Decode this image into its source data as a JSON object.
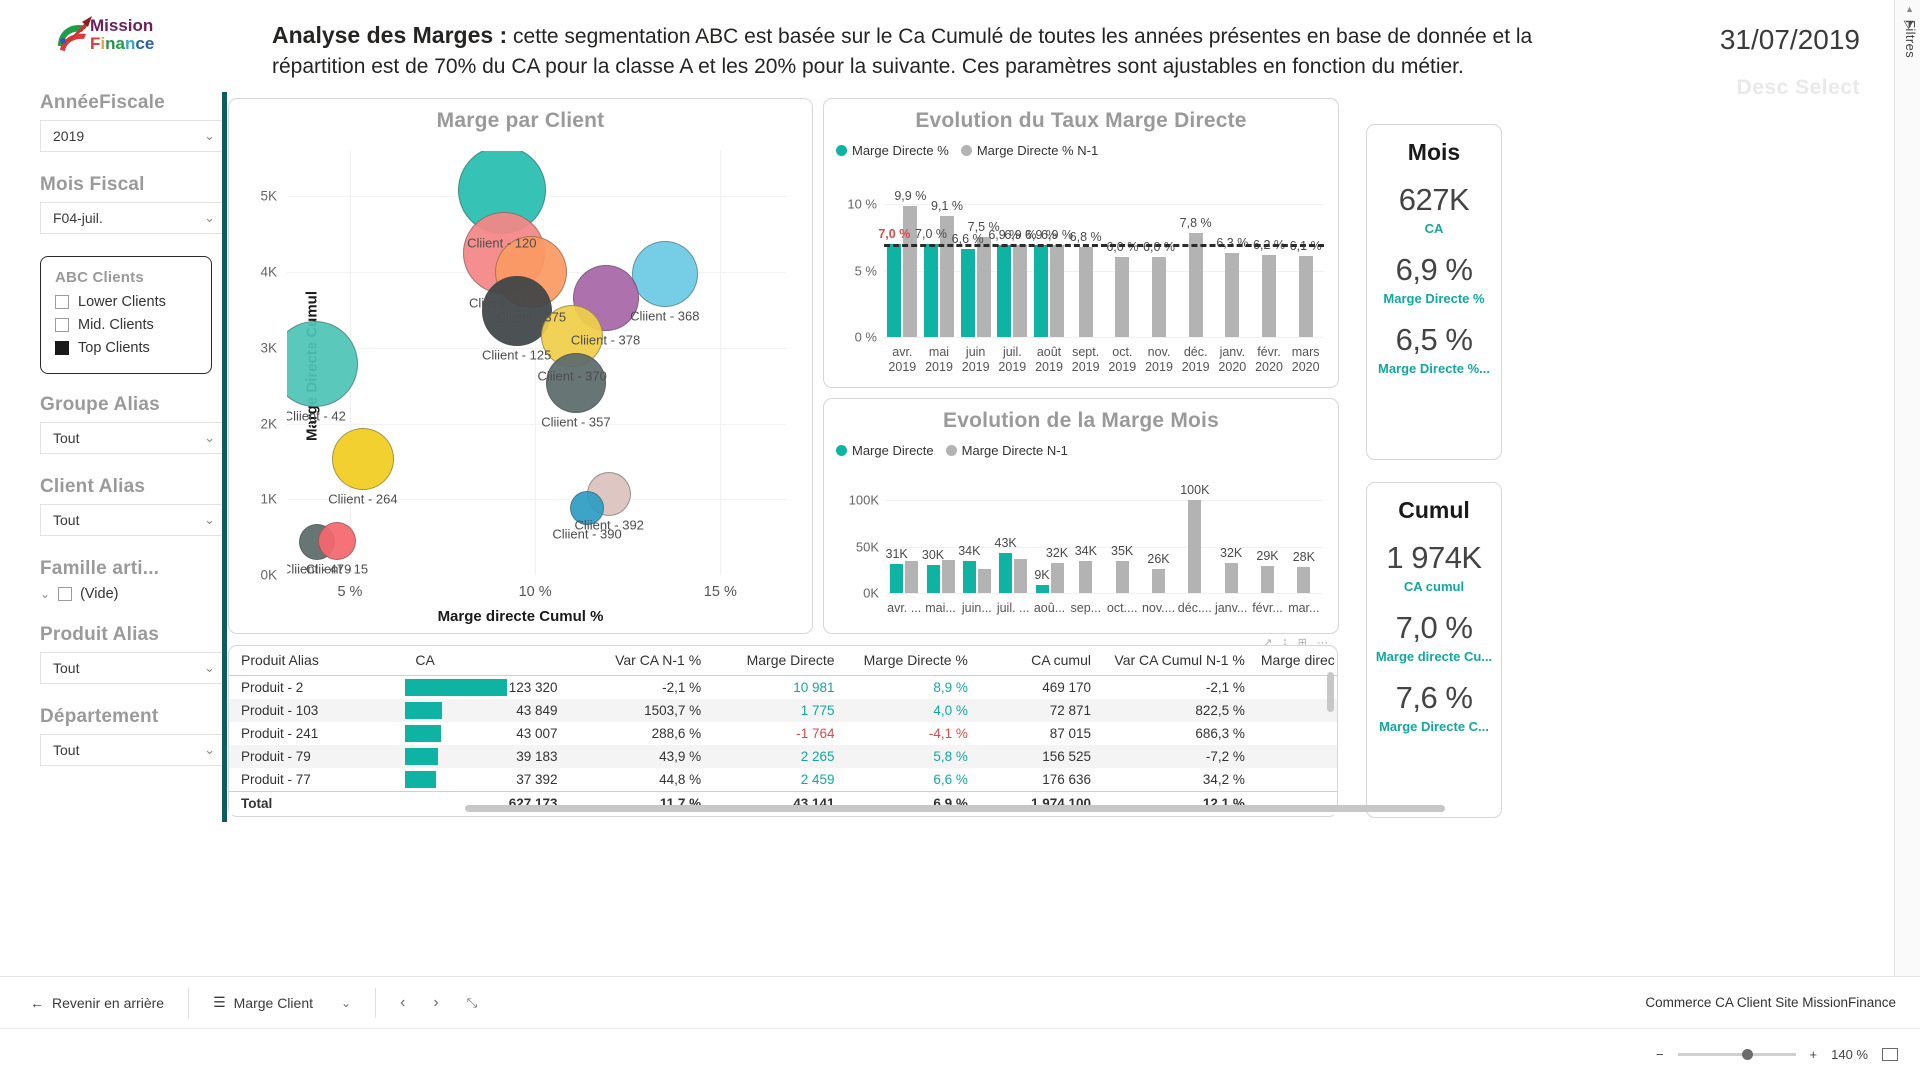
{
  "brand": {
    "line1": "Mission",
    "line2": "Finance"
  },
  "header": {
    "title_bold": "Analyse des Marges :",
    "title_rest": " cette segmentation ABC est basée sur le Ca Cumulé de toutes les années présentes en base de donnée et la répartition est de 70% du CA pour la classe A et les 20% pour la suivante. Ces paramètres sont ajustables en fonction du métier.",
    "date": "31/07/2019",
    "sub": "Desc Select"
  },
  "right_rail": {
    "filters_label": "Filtres",
    "filter_icon": "filter-icon"
  },
  "sidebar": {
    "annee_fiscale": {
      "label": "AnnéeFiscale",
      "value": "2019"
    },
    "mois_fiscal": {
      "label": "Mois Fiscal",
      "value": "F04-juil."
    },
    "abc": {
      "label": "ABC Clients",
      "items": [
        {
          "label": "Lower Clients",
          "checked": false
        },
        {
          "label": "Mid. Clients",
          "checked": false
        },
        {
          "label": "Top Clients",
          "checked": true
        }
      ]
    },
    "groupe_alias": {
      "label": "Groupe Alias",
      "value": "Tout"
    },
    "client_alias": {
      "label": "Client Alias",
      "value": "Tout"
    },
    "famille": {
      "label": "Famille arti...",
      "item": "(Vide)"
    },
    "produit_alias": {
      "label": "Produit Alias",
      "value": "Tout"
    },
    "departement": {
      "label": "Département",
      "value": "Tout"
    }
  },
  "chart_data": [
    {
      "type": "scatter",
      "id": "marge-par-client",
      "title": "Marge par Client",
      "xlabel": "Marge directe Cumul %",
      "ylabel": "Marge Directe Cumul",
      "xlim": [
        3.3,
        16.8
      ],
      "ylim": [
        0,
        5600
      ],
      "xticks": [
        "5 %",
        "10 %",
        "15 %"
      ],
      "xtick_values": [
        5,
        10,
        15
      ],
      "yticks": [
        "0K",
        "1K",
        "2K",
        "3K",
        "4K",
        "5K"
      ],
      "ytick_values": [
        0,
        1000,
        2000,
        3000,
        4000,
        5000
      ],
      "points": [
        {
          "label": "Cliient - 120",
          "x": 9.1,
          "y": 5080,
          "r": 44,
          "color": "#27bfb0"
        },
        {
          "label": "Cliient - 513",
          "x": 9.15,
          "y": 4250,
          "r": 41,
          "color": "#f58787"
        },
        {
          "label": "Cliient - 375",
          "x": 9.9,
          "y": 4000,
          "r": 36,
          "color": "#fb9a63"
        },
        {
          "label": "Cliient - 125",
          "x": 9.5,
          "y": 3490,
          "r": 35,
          "color": "#3f4547"
        },
        {
          "label": "Cliient - 42",
          "x": 4.05,
          "y": 2790,
          "r": 43,
          "color": "#4fc4b8"
        },
        {
          "label": "Cliient - 368",
          "x": 13.5,
          "y": 3980,
          "r": 33,
          "color": "#6ccbe5"
        },
        {
          "label": "Cliient - 378",
          "x": 11.9,
          "y": 3660,
          "r": 33,
          "color": "#a768a8"
        },
        {
          "label": "Cliient - 370",
          "x": 11.0,
          "y": 3160,
          "r": 31,
          "color": "#f0cf4a"
        },
        {
          "label": "Cliient - 357",
          "x": 11.1,
          "y": 2530,
          "r": 30,
          "color": "#5d6b6b"
        },
        {
          "label": "Cliient - 264",
          "x": 5.35,
          "y": 1530,
          "r": 31,
          "color": "#f2cd20"
        },
        {
          "label": "Cliient - 392",
          "x": 12.0,
          "y": 1070,
          "r": 22,
          "color": "#dcc3bf"
        },
        {
          "label": "Cliient - 390",
          "x": 11.4,
          "y": 880,
          "r": 17,
          "color": "#2f9ec4"
        },
        {
          "label": "Cliient - 479",
          "x": 4.1,
          "y": 430,
          "r": 18,
          "color": "#5d6b6b"
        },
        {
          "label": "Cliient - 15",
          "x": 4.65,
          "y": 450,
          "r": 19,
          "color": "#f5696e"
        }
      ]
    },
    {
      "type": "bar",
      "id": "evolution-taux-marge-directe",
      "title": "Evolution du Taux Marge Directe",
      "legend": [
        {
          "name": "Marge Directe %",
          "color": "#0fb3a4"
        },
        {
          "name": "Marge Directe % N-1",
          "color": "#b3b3b3"
        }
      ],
      "categories": [
        "avr.\n2019",
        "mai\n2019",
        "juin\n2019",
        "juil.\n2019",
        "août\n2019",
        "sept.\n2019",
        "oct.\n2019",
        "nov.\n2019",
        "déc.\n2019",
        "janv.\n2020",
        "févr.\n2020",
        "mars\n2020"
      ],
      "series": [
        {
          "name": "Marge Directe %",
          "values": [
            7.0,
            7.0,
            6.6,
            6.9,
            6.9,
            null,
            null,
            null,
            null,
            null,
            null,
            null
          ]
        },
        {
          "name": "Marge Directe % N-1",
          "values": [
            9.9,
            9.1,
            7.5,
            6.9,
            6.9,
            6.8,
            6.0,
            6.0,
            7.8,
            6.3,
            6.2,
            6.1
          ]
        }
      ],
      "labels_current": [
        "7,0 %",
        "7,0 %",
        "6,6 %",
        "6,9 %",
        "6,9 %"
      ],
      "labels_previous": [
        "9,9 %",
        "9,1 %",
        "7,5 %",
        "6,9 %",
        "6,9 %",
        "6,8 %",
        "6,0 %",
        "6,0 %",
        "7,8 %",
        "6,3 %",
        "6,2 %",
        "6,1 %"
      ],
      "yticks": [
        "0 %",
        "5 %",
        "10 %"
      ],
      "ytick_values": [
        0,
        5,
        10
      ],
      "ylim": [
        0,
        11
      ],
      "target_line": 7.0
    },
    {
      "type": "bar",
      "id": "evolution-marge-mois",
      "title": "Evolution de la Marge  Mois",
      "legend": [
        {
          "name": "Marge Directe",
          "color": "#0fb3a4"
        },
        {
          "name": "Marge Directe N-1",
          "color": "#b3b3b3"
        }
      ],
      "categories": [
        "avr. ...",
        "mai...",
        "juin...",
        "juil. ...",
        "aoû...",
        "sep...",
        "oct....",
        "nov....",
        "déc....",
        "janv...",
        "févr...",
        "mar..."
      ],
      "series": [
        {
          "name": "Marge Directe",
          "values": [
            31,
            30,
            34,
            43,
            9,
            null,
            null,
            null,
            null,
            null,
            null,
            null
          ]
        },
        {
          "name": "Marge Directe N-1",
          "values": [
            34,
            36,
            26,
            37,
            32,
            34,
            35,
            26,
            100,
            32,
            29,
            28
          ]
        }
      ],
      "labels_current": [
        "31K",
        "30K",
        "34K",
        "43K",
        "9K"
      ],
      "labels_previous": [
        "",
        "",
        "",
        "",
        "32K",
        "34K",
        "35K",
        "26K",
        "100K",
        "32K",
        "29K",
        "28K"
      ],
      "yticks": [
        "0K",
        "50K",
        "100K"
      ],
      "ytick_values": [
        0,
        50,
        100
      ],
      "ylim": [
        0,
        112
      ]
    }
  ],
  "kpi_mois": {
    "title": "Mois",
    "metrics": [
      {
        "value": "627K",
        "label": "CA"
      },
      {
        "value": "6,9 %",
        "label": "Marge Directe %"
      },
      {
        "value": "6,5 %",
        "label": "Marge Directe %..."
      }
    ]
  },
  "kpi_cumul": {
    "title": "Cumul",
    "metrics": [
      {
        "value": "1 974K",
        "label": "CA cumul"
      },
      {
        "value": "7,0 %",
        "label": "Marge directe Cu..."
      },
      {
        "value": "7,6 %",
        "label": "Marge Directe C..."
      }
    ]
  },
  "table": {
    "columns": [
      "Produit Alias",
      "CA",
      "Var CA N-1 %",
      "Marge Directe",
      "Marge Directe %",
      "CA cumul",
      "Var CA Cumul N-1 %",
      "Marge direc"
    ],
    "rows": [
      {
        "cells": [
          "Produit - 2",
          "123 320",
          "-2,1 %",
          "10 981",
          "8,9 %",
          "469 170",
          "-2,1 %",
          ""
        ],
        "bar_pct": 100,
        "marge_color": "teal"
      },
      {
        "cells": [
          "Produit - 103",
          "43 849",
          "1503,7 %",
          "1 775",
          "4,0 %",
          "72 871",
          "822,5 %",
          ""
        ],
        "bar_pct": 36,
        "marge_color": "teal"
      },
      {
        "cells": [
          "Produit - 241",
          "43 007",
          "288,6 %",
          "-1 764",
          "-4,1 %",
          "87 015",
          "686,3 %",
          ""
        ],
        "bar_pct": 35,
        "marge_color": "red"
      },
      {
        "cells": [
          "Produit - 79",
          "39 183",
          "43,9 %",
          "2 265",
          "5,8 %",
          "156 525",
          "-7,2 %",
          ""
        ],
        "bar_pct": 32,
        "marge_color": "teal"
      },
      {
        "cells": [
          "Produit - 77",
          "37 392",
          "44,8 %",
          "2 459",
          "6,6 %",
          "176 636",
          "34,2 %",
          ""
        ],
        "bar_pct": 30,
        "marge_color": "teal"
      }
    ],
    "total": [
      "Total",
      "627 173",
      "11,7 %",
      "43 141",
      "6,9 %",
      "1 974 100",
      "12,1 %",
      ""
    ]
  },
  "bottom_bar": {
    "back_label": "Revenir en arrière",
    "back_icon": "arrow-left-icon",
    "page_label": "Marge Client",
    "page_icon": "pages-icon",
    "chevron_icon": "chevron-down-icon",
    "prev_icon": "chevron-left-icon",
    "next_icon": "chevron-right-icon",
    "focus_icon": "focus-mode-icon",
    "right_label": "Commerce CA Client Site MissionFinance"
  },
  "status_bar": {
    "zoom": "140 %",
    "minus": "−",
    "plus": "+",
    "fit_icon": "fit-to-page-icon"
  }
}
